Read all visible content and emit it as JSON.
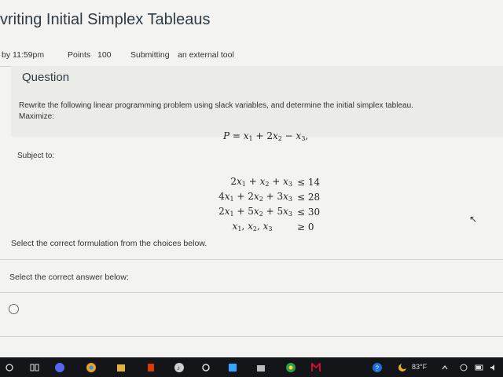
{
  "header": {
    "title": "vriting Initial Simplex Tableaus",
    "due_label": "by 11:59pm",
    "points_label": "Points",
    "points_value": "100",
    "submitting_label": "Submitting",
    "submitting_value": "an external tool"
  },
  "question": {
    "heading": "Question",
    "prompt": "Rewrite the following linear programming problem using slack variables, and determine the initial simplex tableau.",
    "maximize_label": "Maximize:",
    "subject_label": "Subject to:",
    "instruction": "Select the correct formulation from the choices below.",
    "answer_prompt": "Select the correct answer below:"
  },
  "taskbar": {
    "weather": "83°F",
    "icons": [
      "windows-icon",
      "task-view-icon",
      "discord-icon",
      "chrome-icon",
      "files-icon",
      "office-icon",
      "music-icon",
      "steam-icon",
      "photoshop-icon",
      "store-icon",
      "chrome-2-icon",
      "mcafee-icon",
      "help-icon",
      "moon-icon"
    ]
  },
  "colors": {
    "taskbar_bg": "#141518",
    "title_color": "#2d3b45",
    "page_bg": "#f3f3f1"
  }
}
